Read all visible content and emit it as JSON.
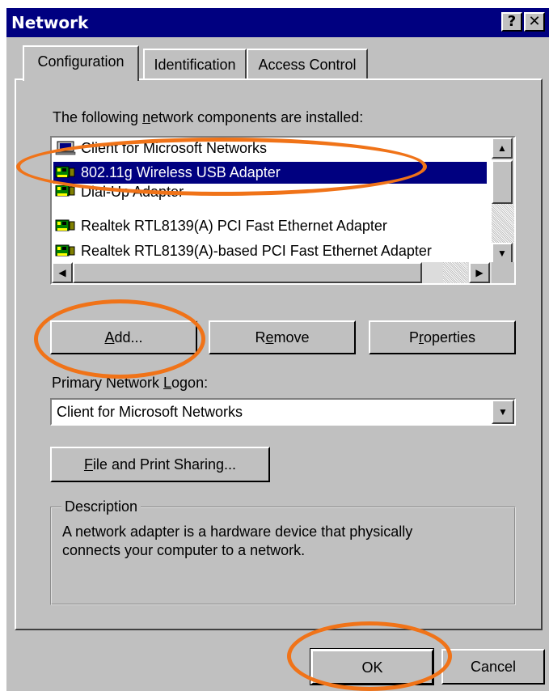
{
  "window": {
    "title": "Network",
    "help_label": "?",
    "close_label": "✕"
  },
  "tabs": [
    {
      "label": "Configuration",
      "active": true
    },
    {
      "label": "Identification",
      "active": false
    },
    {
      "label": "Access Control",
      "active": false
    }
  ],
  "components": {
    "caption_pre": "The following ",
    "caption_accel": "n",
    "caption_post": "etwork components are installed:",
    "items": [
      {
        "label": "Client for Microsoft Networks",
        "icon": "client-icon",
        "selected": false
      },
      {
        "label": "802.11g Wireless USB Adapter",
        "icon": "network-adapter-icon",
        "selected": true
      },
      {
        "label": "Dial-Up Adapter",
        "icon": "network-adapter-icon",
        "selected": false
      },
      {
        "label": "Realtek RTL8139(A) PCI Fast Ethernet Adapter",
        "icon": "network-adapter-icon",
        "selected": false
      },
      {
        "label": "Realtek RTL8139(A)-based PCI Fast Ethernet Adapter",
        "icon": "network-adapter-icon",
        "selected": false
      }
    ]
  },
  "buttons": {
    "add_accel": "A",
    "add_rest": "dd...",
    "remove_pre": "R",
    "remove_accel": "e",
    "remove_post": "move",
    "properties_pre": "P",
    "properties_accel": "r",
    "properties_post": "operties",
    "file_share_accel": "F",
    "file_share_rest": "ile and Print Sharing...",
    "ok": "OK",
    "cancel": "Cancel"
  },
  "logon": {
    "label_pre": "Primary Network ",
    "label_accel": "L",
    "label_post": "ogon:",
    "value": "Client for Microsoft Networks"
  },
  "description": {
    "title": "Description",
    "text_line1": "A network adapter is a hardware device that physically",
    "text_line2": "connects your computer to a network."
  },
  "colors": {
    "titlebar": "#000080",
    "face": "#c0c0c0",
    "selection": "#000080",
    "highlight_circle": "#f07318"
  }
}
